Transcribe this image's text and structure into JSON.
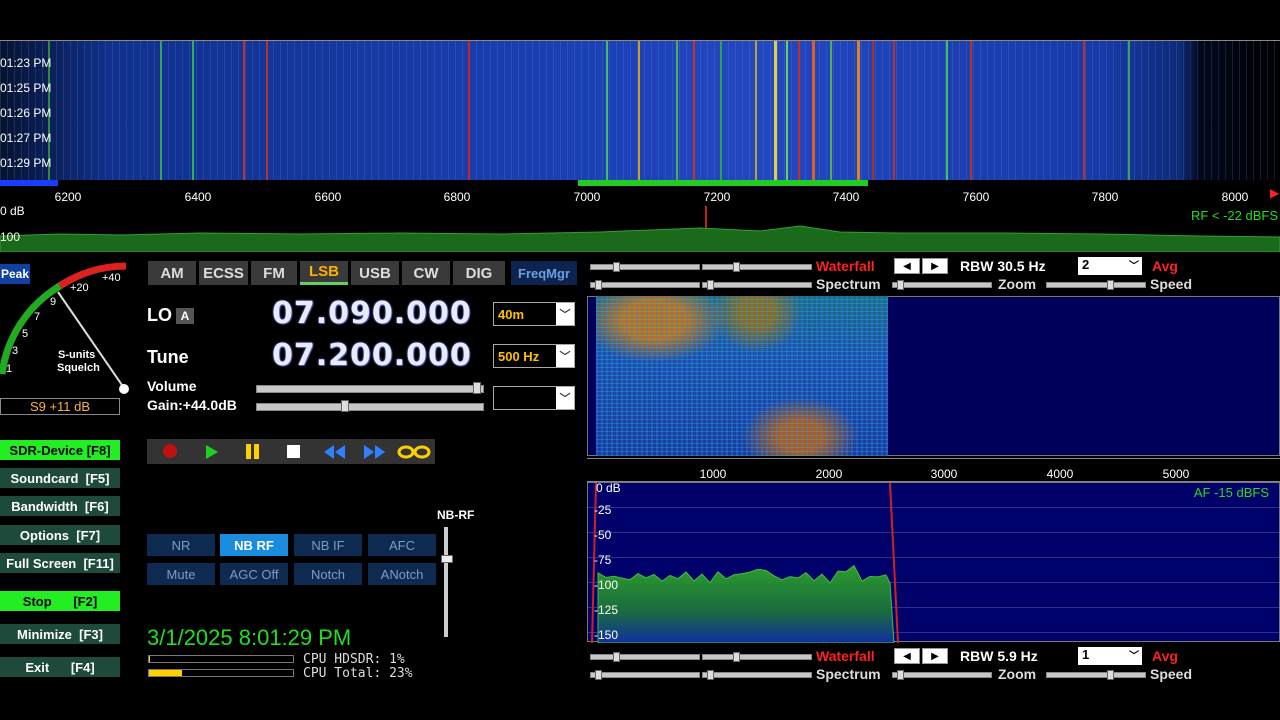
{
  "waterfall_top": {
    "times": [
      "01:23 PM",
      "01:25 PM",
      "01:26 PM",
      "01:27 PM",
      "01:29 PM"
    ],
    "freq_ticks": [
      "6200",
      "6400",
      "6600",
      "6800",
      "7000",
      "7200",
      "7400",
      "7600",
      "7800",
      "8000"
    ],
    "db_labels": [
      "0 dB",
      "100"
    ],
    "rf_level": "RF < -22 dBFS"
  },
  "smeter": {
    "peak_label": "Peak",
    "scale": [
      "+40",
      "+20",
      "9",
      "7",
      "5",
      "3",
      "1"
    ],
    "caption_line1": "S-units",
    "caption_line2": "Squelch",
    "readout": "S9 +11 dB"
  },
  "side_buttons": [
    {
      "label": "SDR-Device [F8]",
      "active": true
    },
    {
      "label": "Soundcard  [F5]",
      "active": false
    },
    {
      "label": "Bandwidth  [F6]",
      "active": false
    },
    {
      "label": "Options  [F7]",
      "active": false
    },
    {
      "label": "Full Screen  [F11]",
      "active": false
    },
    {
      "label": "Stop      [F2]",
      "active": true
    },
    {
      "label": "Minimize  [F3]",
      "active": false
    },
    {
      "label": "Exit      [F4]",
      "active": false
    }
  ],
  "modes": [
    "AM",
    "ECSS",
    "FM",
    "LSB",
    "USB",
    "CW",
    "DIG"
  ],
  "active_mode": "LSB",
  "freqmgr_label": "FreqMgr",
  "lo": {
    "label": "LO",
    "badge": "A",
    "value": "07.090.000",
    "band": "40m"
  },
  "tune": {
    "label": "Tune",
    "value": "07.200.000",
    "step": "500 Hz"
  },
  "volume": {
    "label": "Volume",
    "gain": "Gain:+44.0dB",
    "gain_value": 44.0
  },
  "dsp_buttons_row1": [
    "NR",
    "NB RF",
    "NB IF",
    "AFC"
  ],
  "dsp_buttons_row2": [
    "Mute",
    "AGC Off",
    "Notch",
    "ANotch"
  ],
  "nb_rf_label": "NB-RF",
  "datetime": "3/1/2025 8:01:29 PM",
  "cpu": {
    "hdsdr": "CPU HDSDR: 1%",
    "total": "CPU Total: 23%",
    "hdsdr_pct": 1,
    "total_pct": 23
  },
  "top_controls": {
    "waterfall": "Waterfall",
    "spectrum": "Spectrum",
    "rbw": "RBW 30.5 Hz",
    "avg_value": "2",
    "avg": "Avg",
    "zoom": "Zoom",
    "speed": "Speed"
  },
  "af_ticks": [
    "1000",
    "2000",
    "3000",
    "4000",
    "5000"
  ],
  "af_db": [
    "0 dB",
    "-25",
    "-50",
    "-75",
    "-100",
    "-125",
    "-150"
  ],
  "af_level": "AF -15 dBFS",
  "bottom_controls": {
    "waterfall": "Waterfall",
    "spectrum": "Spectrum",
    "rbw": "RBW  5.9 Hz",
    "avg_value": "1",
    "avg": "Avg",
    "zoom": "Zoom",
    "speed": "Speed"
  },
  "colors": {
    "accent_green": "#22dd22",
    "mode_active": "#ffb000",
    "red_label": "#ff2020",
    "freq_blue": "#e8eaff"
  }
}
